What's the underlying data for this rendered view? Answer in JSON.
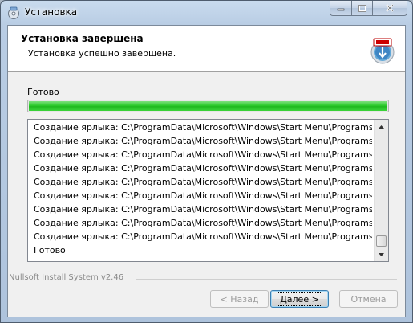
{
  "window": {
    "title": "Установка",
    "icon": "installer-disc-icon"
  },
  "header": {
    "title": "Установка завершена",
    "subtitle": "Установка успешно завершена.",
    "icon": "install-box-icon"
  },
  "status": {
    "label": "Готово",
    "progress": 1.0,
    "progress_color": "#2ccb2c"
  },
  "log": {
    "lines": [
      "Создание ярлыка: C:\\ProgramData\\Microsoft\\Windows\\Start Menu\\Programs\\Autoca",
      "Создание ярлыка: C:\\ProgramData\\Microsoft\\Windows\\Start Menu\\Programs\\Autoca",
      "Создание ярлыка: C:\\ProgramData\\Microsoft\\Windows\\Start Menu\\Programs\\Autoca",
      "Создание ярлыка: C:\\ProgramData\\Microsoft\\Windows\\Start Menu\\Programs\\Autoca",
      "Создание ярлыка: C:\\ProgramData\\Microsoft\\Windows\\Start Menu\\Programs\\Autoca",
      "Создание ярлыка: C:\\ProgramData\\Microsoft\\Windows\\Start Menu\\Programs\\Autoca",
      "Создание ярлыка: C:\\ProgramData\\Microsoft\\Windows\\Start Menu\\Programs\\Autoca",
      "Создание ярлыка: C:\\ProgramData\\Microsoft\\Windows\\Start Menu\\Programs\\Autoca",
      "Создание ярлыка: C:\\ProgramData\\Microsoft\\Windows\\Start Menu\\Programs\\Autoca",
      "Готово"
    ]
  },
  "footer": {
    "branding": "Nullsoft Install System v2.46",
    "back_label": "< Назад",
    "next_label": "Далее >",
    "cancel_label": "Отмена"
  }
}
